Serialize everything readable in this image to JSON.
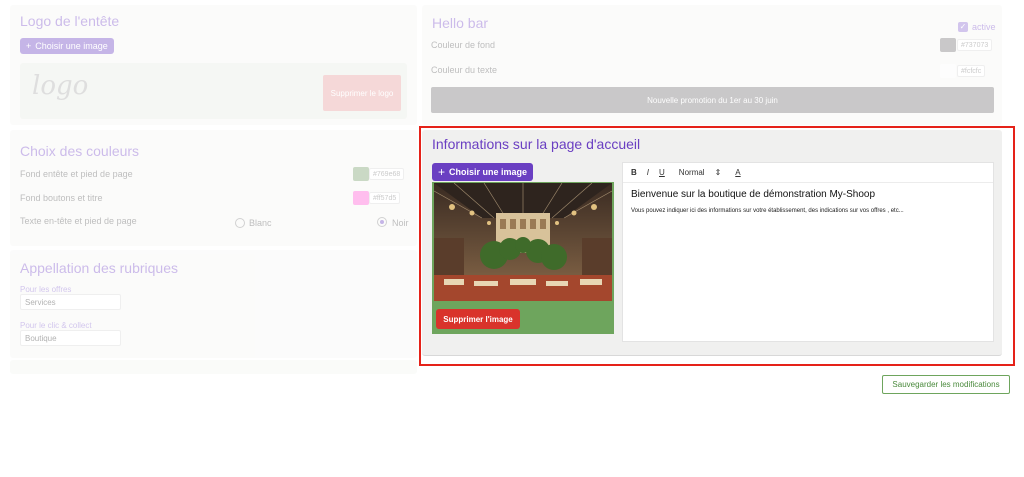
{
  "header_logo": {
    "title": "Logo de l'entête",
    "choose_image": "Choisir une image",
    "logo_text": "logo",
    "delete_logo": "Supprimer le logo"
  },
  "hello_bar": {
    "title": "Hello bar",
    "active_label": "active",
    "bg_label": "Couleur de fond",
    "bg_value": "#737073",
    "text_label": "Couleur du texte",
    "text_value": "#fcfcfc",
    "promo_text": "Nouvelle promotion du 1er au 30 juin"
  },
  "colors": {
    "title": "Choix des couleurs",
    "row1_label": "Fond entête et pied de page",
    "row1_value": "#769e68",
    "row2_label": "Fond boutons et titre",
    "row2_value": "#ff57d5",
    "row3_label": "Texte en-tête et pied de page",
    "option_white": "Blanc",
    "option_black": "Noir"
  },
  "appellation": {
    "title": "Appellation des rubriques",
    "offers_label": "Pour les offres",
    "offers_value": "Services",
    "click_label": "Pour le clic & collect",
    "click_value": "Boutique"
  },
  "home_info": {
    "title": "Informations sur la page d'accueil",
    "choose_image": "Choisir une image",
    "delete_image": "Supprimer l'image",
    "toolbar": {
      "bold": "B",
      "italic": "I",
      "underline": "U",
      "format": "Normal",
      "format_arrow": "⇕",
      "color": "A"
    },
    "heading": "Bienvenue sur la boutique de démonstration My-Shoop",
    "body": "Vous pouvez indiquer ici des informations sur votre établissement, des indications sur vos offres , etc..."
  },
  "save_button": "Sauvegarder les modifications",
  "colors_palette": {
    "purple": "#6a3fc2",
    "red": "#e52219",
    "green": "#6ea55d"
  }
}
